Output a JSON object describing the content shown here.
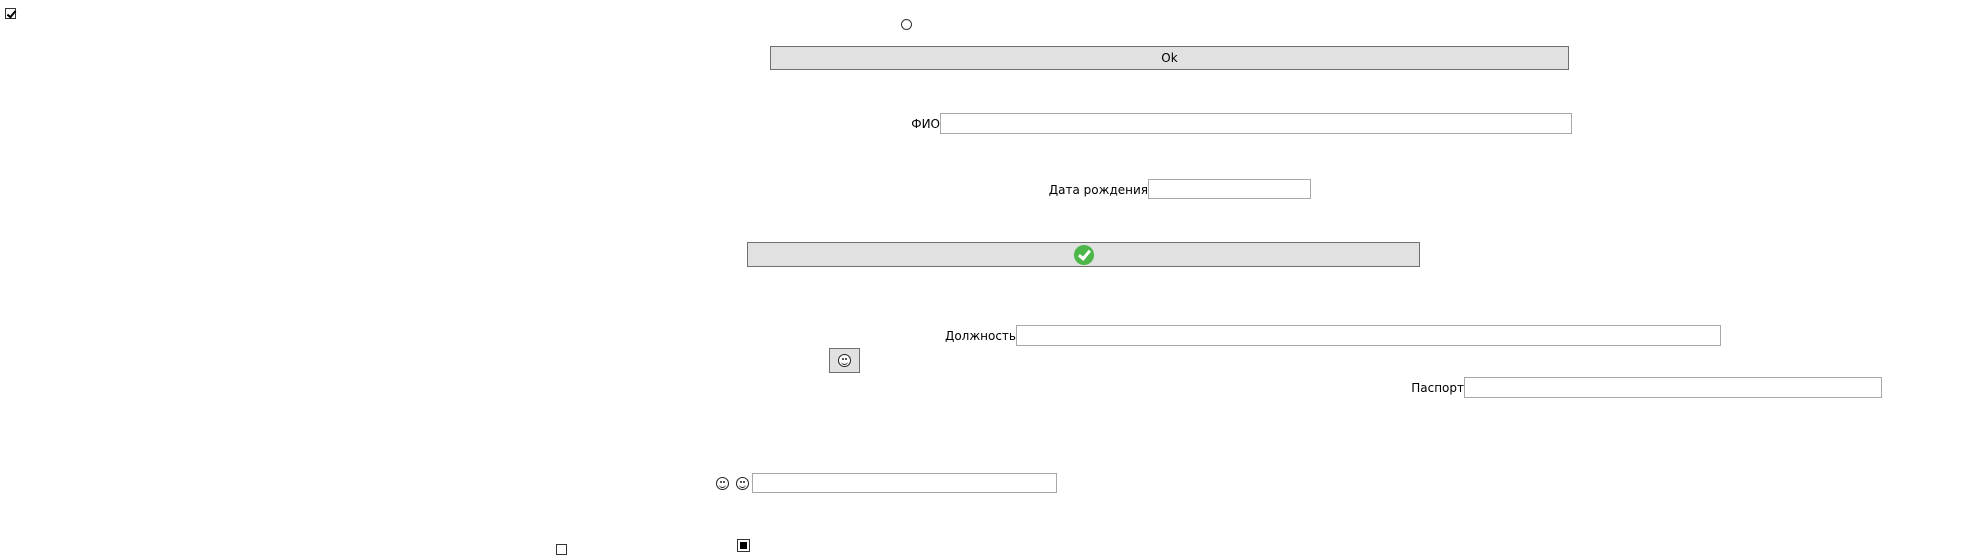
{
  "checkbox_top": {
    "checked": true
  },
  "radio_top": {
    "checked": false
  },
  "ok_button": {
    "label": "Ok"
  },
  "fio": {
    "label": "ФИО",
    "value": ""
  },
  "birth_date": {
    "label": "Дата рождения",
    "value": ""
  },
  "confirm_button": {
    "icon": "check-circle-icon"
  },
  "position": {
    "label": "Должность",
    "value": ""
  },
  "smiley_button": {
    "icon": "smiley-icon"
  },
  "passport": {
    "label": "Паспорт",
    "value": ""
  },
  "emoji_input": {
    "icons": [
      "smiley-icon",
      "smiley-icon"
    ],
    "value": ""
  },
  "checkbox_bottom": {
    "checked": false
  },
  "square_radio_bottom": {
    "checked": true
  }
}
